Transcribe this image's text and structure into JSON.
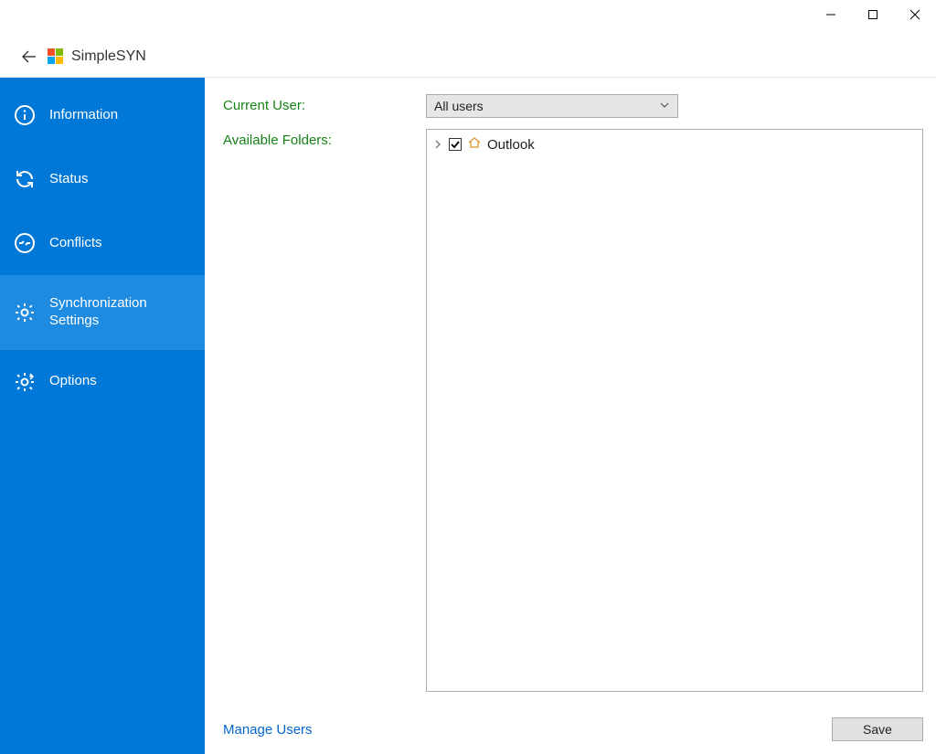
{
  "app": {
    "title": "SimpleSYN"
  },
  "sidebar": {
    "items": [
      {
        "label": "Information"
      },
      {
        "label": "Status"
      },
      {
        "label": "Conflicts"
      },
      {
        "label": "Synchronization Settings"
      },
      {
        "label": "Options"
      }
    ]
  },
  "main": {
    "current_user_label": "Current User:",
    "current_user_value": "All users",
    "available_folders_label": "Available Folders:",
    "tree": {
      "root_label": "Outlook"
    },
    "manage_users_link": "Manage Users",
    "save_button": "Save"
  }
}
